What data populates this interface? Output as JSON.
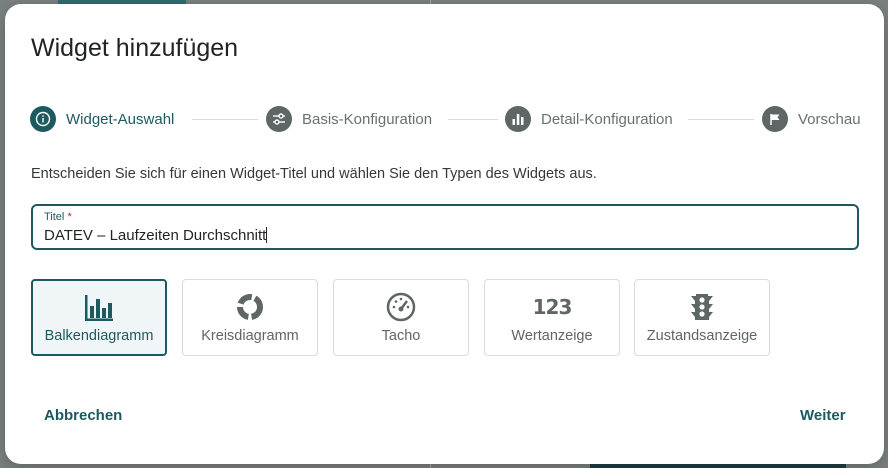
{
  "dialog": {
    "title": "Widget hinzufügen",
    "description": "Entscheiden Sie sich für einen Widget-Titel und wählen Sie den Typen des Widgets aus."
  },
  "stepper": {
    "steps": [
      {
        "label": "Widget-Auswahl",
        "icon": "info-icon",
        "active": true
      },
      {
        "label": "Basis-Konfiguration",
        "icon": "sliders-icon",
        "active": false
      },
      {
        "label": "Detail-Konfiguration",
        "icon": "bar-chart-icon",
        "active": false
      },
      {
        "label": "Vorschau",
        "icon": "flag-icon",
        "active": false
      }
    ]
  },
  "title_field": {
    "label": "Titel",
    "required_marker": "*",
    "value": "DATEV – Laufzeiten Durchschnitt"
  },
  "widget_types": [
    {
      "label": "Balkendiagramm",
      "icon": "bar-chart-icon",
      "selected": true
    },
    {
      "label": "Kreisdiagramm",
      "icon": "donut-chart-icon",
      "selected": false
    },
    {
      "label": "Tacho",
      "icon": "speedometer-icon",
      "selected": false
    },
    {
      "label": "Wertanzeige",
      "icon": "numbers-icon",
      "icon_text": "123",
      "selected": false
    },
    {
      "label": "Zustandsanzeige",
      "icon": "traffic-light-icon",
      "selected": false
    }
  ],
  "actions": {
    "cancel_label": "Abbrechen",
    "next_label": "Weiter"
  },
  "colors": {
    "primary": "#1c5a60",
    "required": "#c0272d",
    "muted": "#5f6666"
  }
}
